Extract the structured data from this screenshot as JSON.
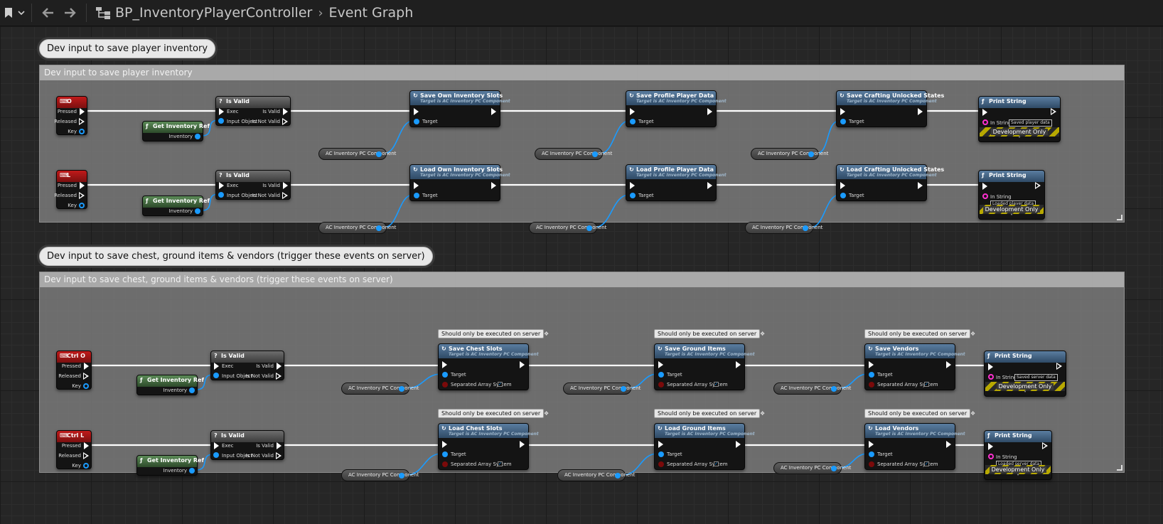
{
  "toolbar": {
    "blueprint_name": "BP_InventoryPlayerController",
    "graph_name": "Event Graph"
  },
  "comments": [
    {
      "bubble": "Dev input to save player inventory",
      "header": "Dev input to save player inventory"
    },
    {
      "bubble": "Dev input to save chest, ground items & vendors (trigger these events on server)",
      "header": "Dev input to save chest, ground items & vendors (trigger these events on server)"
    }
  ],
  "labels": {
    "pressed": "Pressed",
    "released": "Released",
    "key": "Key",
    "is_valid": "Is Valid",
    "exec": "Exec",
    "input_object": "Input Object",
    "is_valid_out": "Is Valid",
    "is_not_valid": "Is Not Valid",
    "get_inventory_ref": "Get Inventory Ref",
    "inventory": "Inventory",
    "ac_component": "AC Inventory PC Component",
    "target": "Target",
    "target_is": "Target is AC Inventory PC Component",
    "separated_array_system": "Separated Array System",
    "print_string": "Print String",
    "in_string": "In String",
    "dev_only": "Development Only",
    "server_note": "Should only be executed on server"
  },
  "rows": [
    {
      "key": "O",
      "f1": "Save Own Inventory Slots",
      "f2": "Save Profile Player Data",
      "f3": "Save Crafting Unlocked States",
      "print": "Saved player data"
    },
    {
      "key": "L",
      "f1": "Load Own Inventory Slots",
      "f2": "Load Profile Player Data",
      "f3": "Load Crafting Unlocked States",
      "print": "Loaded player data"
    },
    {
      "key": "Ctrl O",
      "f1": "Save Chest Slots",
      "f2": "Save Ground Items",
      "f3": "Save Vendors",
      "print": "Saved server data"
    },
    {
      "key": "Ctrl L",
      "f1": "Load Chest Slots",
      "f2": "Load Ground Items",
      "f3": "Load Vendors",
      "print": "Loaded server data"
    }
  ],
  "colors": {
    "exec_wire": "#ffffff",
    "object_wire": "#1a9bff",
    "event_header": "#c11a1a",
    "function_header": "#5a7da0"
  },
  "icons": [
    "bookmark-icon",
    "chevron-down-icon",
    "back-arrow-icon",
    "forward-arrow-icon",
    "blueprint-hierarchy-icon",
    "keyboard-event-icon",
    "function-icon",
    "macro-icon"
  ]
}
